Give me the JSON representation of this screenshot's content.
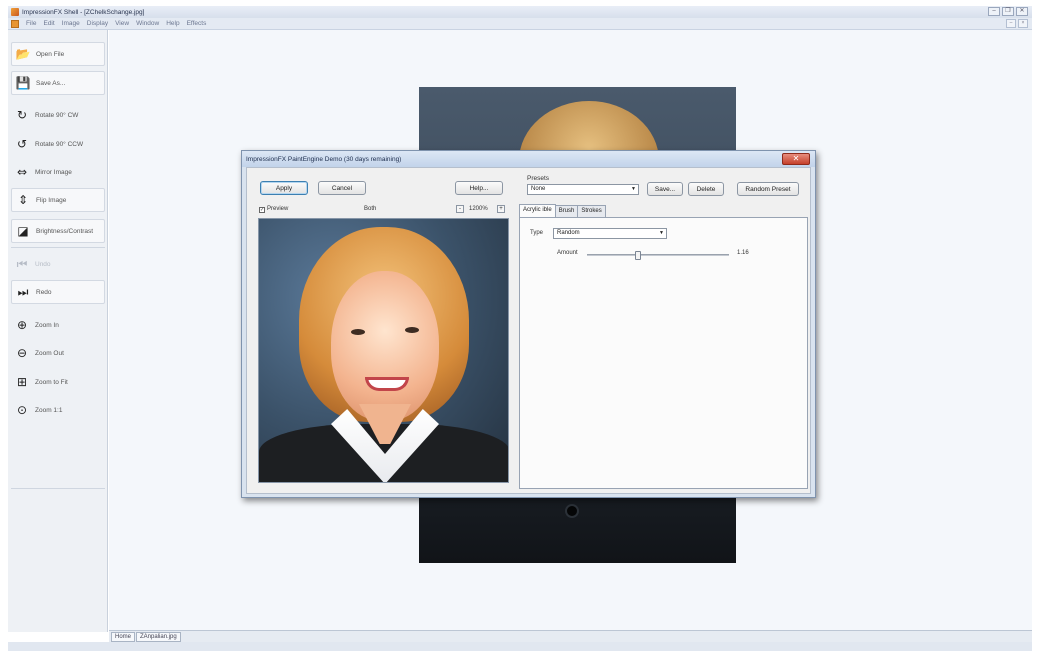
{
  "app": {
    "title": "ImpressionFX Shell - [ZChelkSchange.jpg]",
    "window_controls": [
      "–",
      "❐",
      "✕"
    ]
  },
  "menu": {
    "items": [
      "File",
      "Edit",
      "Image",
      "Display",
      "View",
      "Window",
      "Help",
      "Effects"
    ],
    "mdi_controls": [
      "–",
      "×"
    ]
  },
  "toolbar": {
    "open_file": "Open File",
    "save_as": "Save As...",
    "rotate_cw": "Rotate 90° CW",
    "rotate_ccw": "Rotate 90° CCW",
    "mirror_image": "Mirror Image",
    "flip_image": "Flip Image",
    "brightness_contrast": "Brightness/Contrast",
    "undo": "Undo",
    "redo": "Redo",
    "zoom_in": "Zoom In",
    "zoom_out": "Zoom Out",
    "zoom_to_fit": "Zoom to Fit",
    "zoom_1_1": "Zoom 1:1"
  },
  "dialog": {
    "title": "ImpressionFX PaintEngine Demo (30 days remaining)",
    "close": "✕",
    "apply": "Apply",
    "cancel": "Cancel",
    "help": "Help...",
    "preview_label": "Preview",
    "preview_mode": "Both",
    "zoom_minus": "-",
    "zoom_value": "1200%",
    "zoom_plus": "+",
    "presets_label": "Presets",
    "preset_selected": "None",
    "save": "Save...",
    "delete": "Delete",
    "random_preset": "Random Preset",
    "tabs": [
      "Acrylic ible",
      "Brush",
      "Strokes"
    ],
    "type_label": "Type",
    "type_value": "Random",
    "amount_label": "Amount",
    "amount_value": "1.16",
    "amount_level": 0.35
  },
  "doc_tabs": [
    "Home",
    "ZAnpalian.jpg"
  ]
}
